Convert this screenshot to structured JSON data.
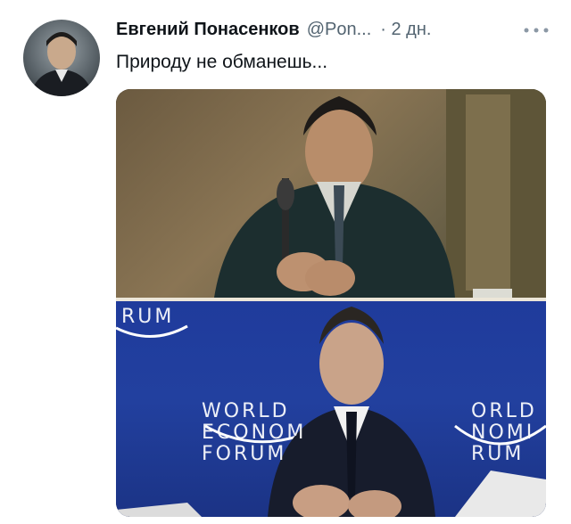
{
  "tweet": {
    "author_name": "Евгений Понасенков",
    "handle": "@Pon...",
    "timestamp": "· 2 дн.",
    "more_icon": "more-horizontal-icon",
    "text": "Природу не обманешь..."
  },
  "media": {
    "wef_logo_left": "WORLD\nECONOM\nFORUM",
    "wef_logo_right": "ORLD\nNOMI\nRUM",
    "wef_top_left": "RUM",
    "colors": {
      "wef_blue": "#22409f"
    }
  }
}
